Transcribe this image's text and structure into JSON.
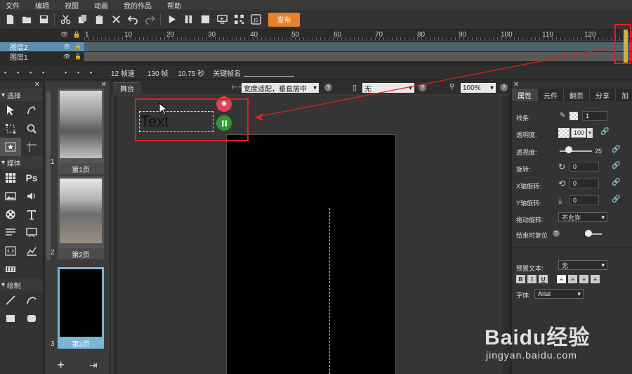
{
  "menu": [
    "文件",
    "编辑",
    "视图",
    "动画",
    "我的作品",
    "帮助"
  ],
  "toolbar": {
    "publish_label": "发布"
  },
  "timeline": {
    "ticks": [
      "1",
      "10",
      "20",
      "30",
      "40",
      "50",
      "60",
      "70",
      "80",
      "90",
      "100",
      "110",
      "120",
      "13"
    ],
    "layers": [
      {
        "name": "图层2",
        "selected": true
      },
      {
        "name": "图层1",
        "selected": false
      }
    ]
  },
  "infobar": {
    "fps": "12 帧速",
    "frames": "130 帧",
    "duration": "10.75 秒",
    "keyframe_label": "关键帧名"
  },
  "left_panel": {
    "sections": [
      "选择",
      "媒体",
      "绘制"
    ],
    "media_ps": "Ps"
  },
  "pages": {
    "items": [
      {
        "num": "1",
        "label": "第1页",
        "selected": false
      },
      {
        "num": "2",
        "label": "第2页",
        "selected": false
      },
      {
        "num": "3",
        "label": "第3页",
        "selected": true
      }
    ]
  },
  "stage": {
    "tab": "舞台",
    "fit_mode": "宽度适配，垂直居中",
    "device": "无",
    "zoom": "100%",
    "text_element": "Text",
    "help": "?"
  },
  "properties": {
    "tabs": [
      "属性",
      "元件",
      "翻页",
      "分享",
      "加"
    ],
    "stroke_label": "线条:",
    "stroke_value": "1",
    "opacity_label": "透明度:",
    "opacity_value": "100",
    "perspective_label": "透视度:",
    "perspective_value": "25",
    "rotate_label": "旋转:",
    "rotate_value": "0",
    "xrotate_label": "X轴旋转:",
    "xrotate_value": "0",
    "yrotate_label": "Y轴旋转:",
    "yrotate_value": "0",
    "drag_rotate_label": "拖动旋转:",
    "drag_rotate_value": "不允许",
    "reset_label": "结束时复位",
    "preset_text_label": "预置文本:",
    "preset_text_value": "无",
    "font_label": "字体:",
    "font_value": "Arial",
    "bold": "B",
    "italic": "I",
    "underline": "U"
  },
  "watermark": {
    "main": "Baidu经验",
    "sub": "jingyan.baidu.com"
  }
}
